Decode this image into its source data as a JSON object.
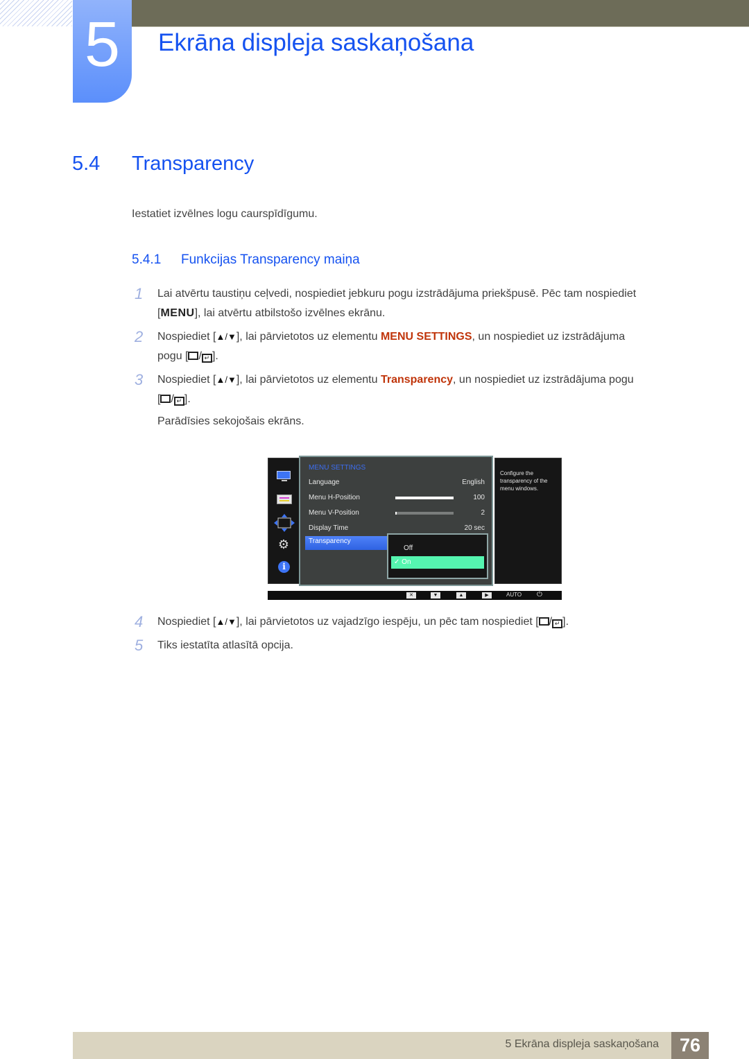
{
  "header": {
    "chapter_number": "5",
    "chapter_title": "Ekrāna displeja saskaņošana"
  },
  "section": {
    "number": "5.4",
    "title": "Transparency",
    "intro": "Iestatiet izvēlnes logu caurspīdīgumu."
  },
  "subsection": {
    "number": "5.4.1",
    "title": "Funkcijas Transparency maiņa"
  },
  "steps": [
    {
      "n": "1",
      "line1": "Lai atvērtu taustiņu ceļvedi, nospiediet jebkuru pogu izstrādājuma priekšpusē. Pēc tam nospiediet",
      "key": "MENU",
      "line2": ", lai atvērtu atbilstošo izvēlnes ekrānu."
    },
    {
      "n": "2",
      "pre": "Nospiediet [",
      "mid": "], lai pārvietotos uz elementu ",
      "highlight": "MENU SETTINGS",
      "post": ", un nospiediet uz izstrādājuma",
      "line2_pre": "pogu [",
      "line2_post": "]."
    },
    {
      "n": "3",
      "pre": "Nospiediet [",
      "mid": "], lai pārvietotos uz elementu ",
      "highlight": "Transparency",
      "post": ", un nospiediet uz izstrādājuma pogu",
      "line2_pre": "[",
      "line2_post": "].",
      "note": "Parādīsies sekojošais ekrāns."
    },
    {
      "n": "4",
      "pre": "Nospiediet [",
      "mid": "], lai pārvietotos uz vajadzīgo iespēju, un pēc tam nospiediet [",
      "post": "]."
    },
    {
      "n": "5",
      "text": "Tiks iestatīta atlasītā opcija."
    }
  ],
  "symbols": {
    "up_down": "▲/▼",
    "slash": "/",
    "bracket_open": "[",
    "bracket_close": "]"
  },
  "osd": {
    "menu_title": "MENU SETTINGS",
    "rows": [
      {
        "label": "Language",
        "value": "English"
      },
      {
        "label": "Menu H-Position",
        "value": "100",
        "slider_percent": 100
      },
      {
        "label": "Menu V-Position",
        "value": "2",
        "slider_percent": 2
      },
      {
        "label": "Display Time",
        "value": "20 sec"
      }
    ],
    "selected_item": "Transparency",
    "options": [
      {
        "label": "Off",
        "selected": false
      },
      {
        "label": "On",
        "selected": true
      }
    ],
    "check_mark": "✓",
    "help_text": "Configure the transparency of the menu windows.",
    "bottom_bar": {
      "buttons": [
        "✕",
        "▼",
        "▲",
        "▶"
      ],
      "auto_label": "AUTO",
      "power_icon": "⏻"
    },
    "side_icons": [
      "monitor-icon",
      "picture-icon",
      "position-icon",
      "gear-icon",
      "info-icon"
    ],
    "colors": {
      "accent_blue": "#3d6ef2",
      "selected_option": "#55f5b0"
    }
  },
  "footer": {
    "text": "5 Ekrāna displeja saskaņošana",
    "page_number": "76"
  },
  "colors": {
    "heading_blue": "#1552f0",
    "highlight_red": "#c0350b",
    "topbar": "#6d6c58",
    "footer_bg": "#dad4c0",
    "page_badge": "#8c8274"
  }
}
